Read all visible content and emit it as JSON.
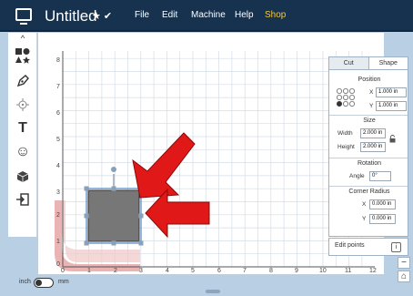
{
  "window": {
    "title": "Untitled",
    "title_extra": "★ ✔"
  },
  "menu": {
    "items": [
      "File",
      "Edit",
      "Machine",
      "Help",
      "Shop"
    ]
  },
  "left_tools": {
    "collapse": "^",
    "items": [
      {
        "name": "shapes-icon"
      },
      {
        "name": "pen-icon"
      },
      {
        "name": "target-icon"
      },
      {
        "name": "text-icon",
        "glyph": "T"
      },
      {
        "name": "smiley-icon",
        "glyph": "☺"
      },
      {
        "name": "library-icon"
      },
      {
        "name": "import-icon"
      }
    ]
  },
  "ruler": {
    "y_labels": [
      "8",
      "7",
      "6",
      "5",
      "4",
      "3",
      "2",
      "1",
      "0"
    ],
    "x_labels": [
      "0",
      "1",
      "2",
      "3",
      "4",
      "5",
      "6",
      "7",
      "8",
      "9",
      "10",
      "11",
      "12"
    ]
  },
  "panel": {
    "tabs": [
      "Cut",
      "Shape"
    ],
    "active_tab": "Shape",
    "position": {
      "label": "Position",
      "x_label": "X",
      "x_value": "1.000 in",
      "y_label": "Y",
      "y_value": "1.000 in"
    },
    "size": {
      "label": "Size",
      "width_label": "Width",
      "width_value": "2.000 in",
      "height_label": "Height",
      "height_value": "2.000 in"
    },
    "rotation": {
      "label": "Rotation",
      "angle_label": "Angle",
      "angle_value": "0°"
    },
    "corner_radius": {
      "label": "Corner Radius",
      "x_label": "X",
      "x_value": "0.000 in",
      "y_label": "Y",
      "y_value": "0.000 in"
    },
    "edit_points": "Edit points"
  },
  "units": {
    "left": "inch",
    "right": "mm"
  },
  "zoom": {
    "in": "−",
    "out": "+",
    "fit": "⌂"
  },
  "colors": {
    "topbar": "#16324e",
    "shop": "#f3c63d",
    "selected_shape": "#777777",
    "arrow": "#e01818",
    "mat_edge": "#e6a7a7"
  }
}
